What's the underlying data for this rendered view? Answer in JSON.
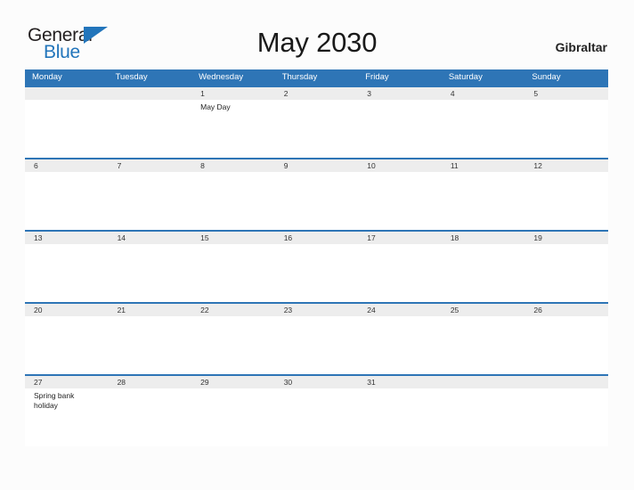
{
  "brand": {
    "name_part1": "General",
    "name_part2": "Blue"
  },
  "header": {
    "title": "May 2030",
    "location": "Gibraltar"
  },
  "calendar": {
    "weekdays": [
      "Monday",
      "Tuesday",
      "Wednesday",
      "Thursday",
      "Friday",
      "Saturday",
      "Sunday"
    ],
    "accent_color": "#2e75b6",
    "stripe_color": "#ededed",
    "weeks": [
      [
        {
          "date": "",
          "event": ""
        },
        {
          "date": "",
          "event": ""
        },
        {
          "date": "1",
          "event": "May Day"
        },
        {
          "date": "2",
          "event": ""
        },
        {
          "date": "3",
          "event": ""
        },
        {
          "date": "4",
          "event": ""
        },
        {
          "date": "5",
          "event": ""
        }
      ],
      [
        {
          "date": "6",
          "event": ""
        },
        {
          "date": "7",
          "event": ""
        },
        {
          "date": "8",
          "event": ""
        },
        {
          "date": "9",
          "event": ""
        },
        {
          "date": "10",
          "event": ""
        },
        {
          "date": "11",
          "event": ""
        },
        {
          "date": "12",
          "event": ""
        }
      ],
      [
        {
          "date": "13",
          "event": ""
        },
        {
          "date": "14",
          "event": ""
        },
        {
          "date": "15",
          "event": ""
        },
        {
          "date": "16",
          "event": ""
        },
        {
          "date": "17",
          "event": ""
        },
        {
          "date": "18",
          "event": ""
        },
        {
          "date": "19",
          "event": ""
        }
      ],
      [
        {
          "date": "20",
          "event": ""
        },
        {
          "date": "21",
          "event": ""
        },
        {
          "date": "22",
          "event": ""
        },
        {
          "date": "23",
          "event": ""
        },
        {
          "date": "24",
          "event": ""
        },
        {
          "date": "25",
          "event": ""
        },
        {
          "date": "26",
          "event": ""
        }
      ],
      [
        {
          "date": "27",
          "event": "Spring bank holiday"
        },
        {
          "date": "28",
          "event": ""
        },
        {
          "date": "29",
          "event": ""
        },
        {
          "date": "30",
          "event": ""
        },
        {
          "date": "31",
          "event": ""
        },
        {
          "date": "",
          "event": ""
        },
        {
          "date": "",
          "event": ""
        }
      ]
    ]
  }
}
